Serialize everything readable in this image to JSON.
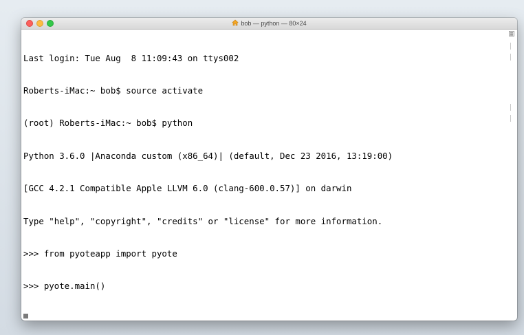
{
  "window": {
    "title": "bob — python — 80×24",
    "title_icon": "home-icon"
  },
  "traffic_lights": {
    "close": "#fc605c",
    "minimize": "#fdbc40",
    "zoom": "#34c84a"
  },
  "terminal": {
    "lines": [
      "Last login: Tue Aug  8 11:09:43 on ttys002",
      "Roberts-iMac:~ bob$ source activate",
      "(root) Roberts-iMac:~ bob$ python",
      "Python 3.6.0 |Anaconda custom (x86_64)| (default, Dec 23 2016, 13:19:00)",
      "[GCC 4.2.1 Compatible Apple LLVM 6.0 (clang-600.0.57)] on darwin",
      "Type \"help\", \"copyright\", \"credits\" or \"license\" for more information.",
      ">>> from pyoteapp import pyote",
      ">>> pyote.main()"
    ]
  }
}
